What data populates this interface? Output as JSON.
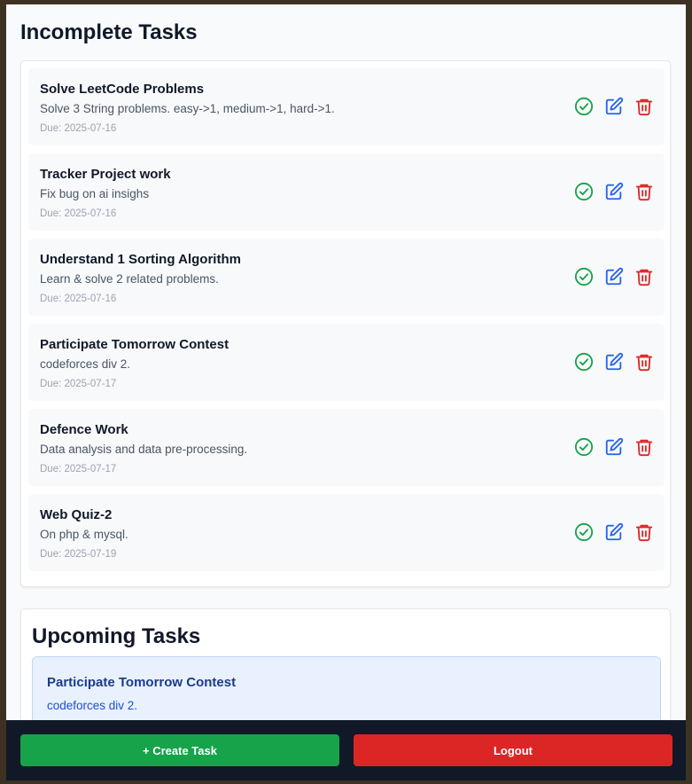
{
  "incomplete": {
    "heading": "Incomplete Tasks",
    "tasks": [
      {
        "title": "Solve LeetCode Problems",
        "description": "Solve 3 String problems. easy->1, medium->1, hard->1.",
        "due": "Due: 2025-07-16"
      },
      {
        "title": "Tracker Project work",
        "description": "Fix bug on ai insighs",
        "due": "Due: 2025-07-16"
      },
      {
        "title": "Understand 1 Sorting Algorithm",
        "description": "Learn & solve 2 related problems.",
        "due": "Due: 2025-07-16"
      },
      {
        "title": "Participate Tomorrow Contest",
        "description": "codeforces div 2.",
        "due": "Due: 2025-07-17"
      },
      {
        "title": "Defence Work",
        "description": "Data analysis and data pre-processing.",
        "due": "Due: 2025-07-17"
      },
      {
        "title": "Web Quiz-2",
        "description": "On php & mysql.",
        "due": "Due: 2025-07-19"
      }
    ],
    "icons": {
      "complete": "check-circle-icon",
      "edit": "edit-icon",
      "delete": "trash-icon"
    }
  },
  "upcoming": {
    "heading": "Upcoming Tasks",
    "tasks": [
      {
        "title": "Participate Tomorrow Contest",
        "description": "codeforces div 2."
      }
    ]
  },
  "footer": {
    "create_label": "+ Create Task",
    "logout_label": "Logout"
  },
  "colors": {
    "complete": "#16a34a",
    "edit": "#2563eb",
    "delete": "#dc2626",
    "footer_bg": "#111827"
  }
}
